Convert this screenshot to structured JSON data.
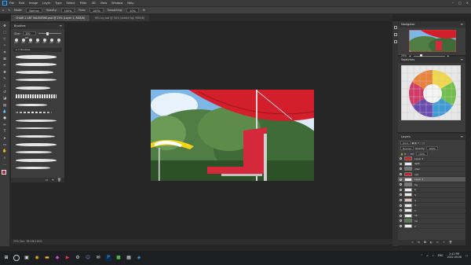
{
  "app": {
    "logo": "Ps",
    "menus": [
      "File",
      "Edit",
      "Image",
      "Layer",
      "Type",
      "Select",
      "Filter",
      "3D",
      "View",
      "Window",
      "Help"
    ]
  },
  "options": {
    "mode_label": "Mode:",
    "mode_value": "Normal",
    "opacity_label": "Opacity:",
    "opacity_value": "100%",
    "flow_label": "Flow:",
    "flow_value": "100%",
    "smoothing_label": "Smoothing:",
    "smoothing_value": "10%"
  },
  "tabs": [
    "CHAIR 2 ART VALENTINE.psd @ 25% (Layer 1, RGB/8)",
    "REL by psd @ 50% (sketch bg, RGB/8)"
  ],
  "brushes_panel": {
    "title": "Brushes",
    "size_label": "Size:",
    "size_value": "100 px",
    "tips": [
      "200",
      "200",
      "200",
      "200",
      "200",
      "200",
      "200"
    ],
    "folder": "Brushes"
  },
  "status": {
    "text": "25%     Doc: 36.0M/1.80G"
  },
  "navigator": {
    "title": "Navigator",
    "zoom": "25%"
  },
  "swatches": {
    "title": "Swatches"
  },
  "layers": {
    "title": "Layers",
    "kind_label": "Kind",
    "blend_mode": "Normal",
    "opacity_label": "Opacity:",
    "opacity_value": "100%",
    "fill_label": "Fill:",
    "fill_value": "100%",
    "rows": [
      {
        "name": "Layer 2"
      },
      {
        "name": "light"
      },
      {
        "name": "chair"
      },
      {
        "name": "red"
      },
      {
        "name": "Layer 1"
      },
      {
        "name": "bg"
      },
      {
        "name": "6"
      },
      {
        "name": "5"
      },
      {
        "name": "4"
      },
      {
        "name": "3"
      },
      {
        "name": "2"
      },
      {
        "name": "1b"
      },
      {
        "name": "1a"
      },
      {
        "name": "1"
      }
    ]
  },
  "taskbar": {
    "time": "2:41 PM",
    "date": "2022-09-08",
    "lang": "ENG"
  },
  "colors": {
    "ps_blue": "#31a8ff",
    "chair_red": "#c8202c",
    "sky": "#7eb6e6"
  }
}
